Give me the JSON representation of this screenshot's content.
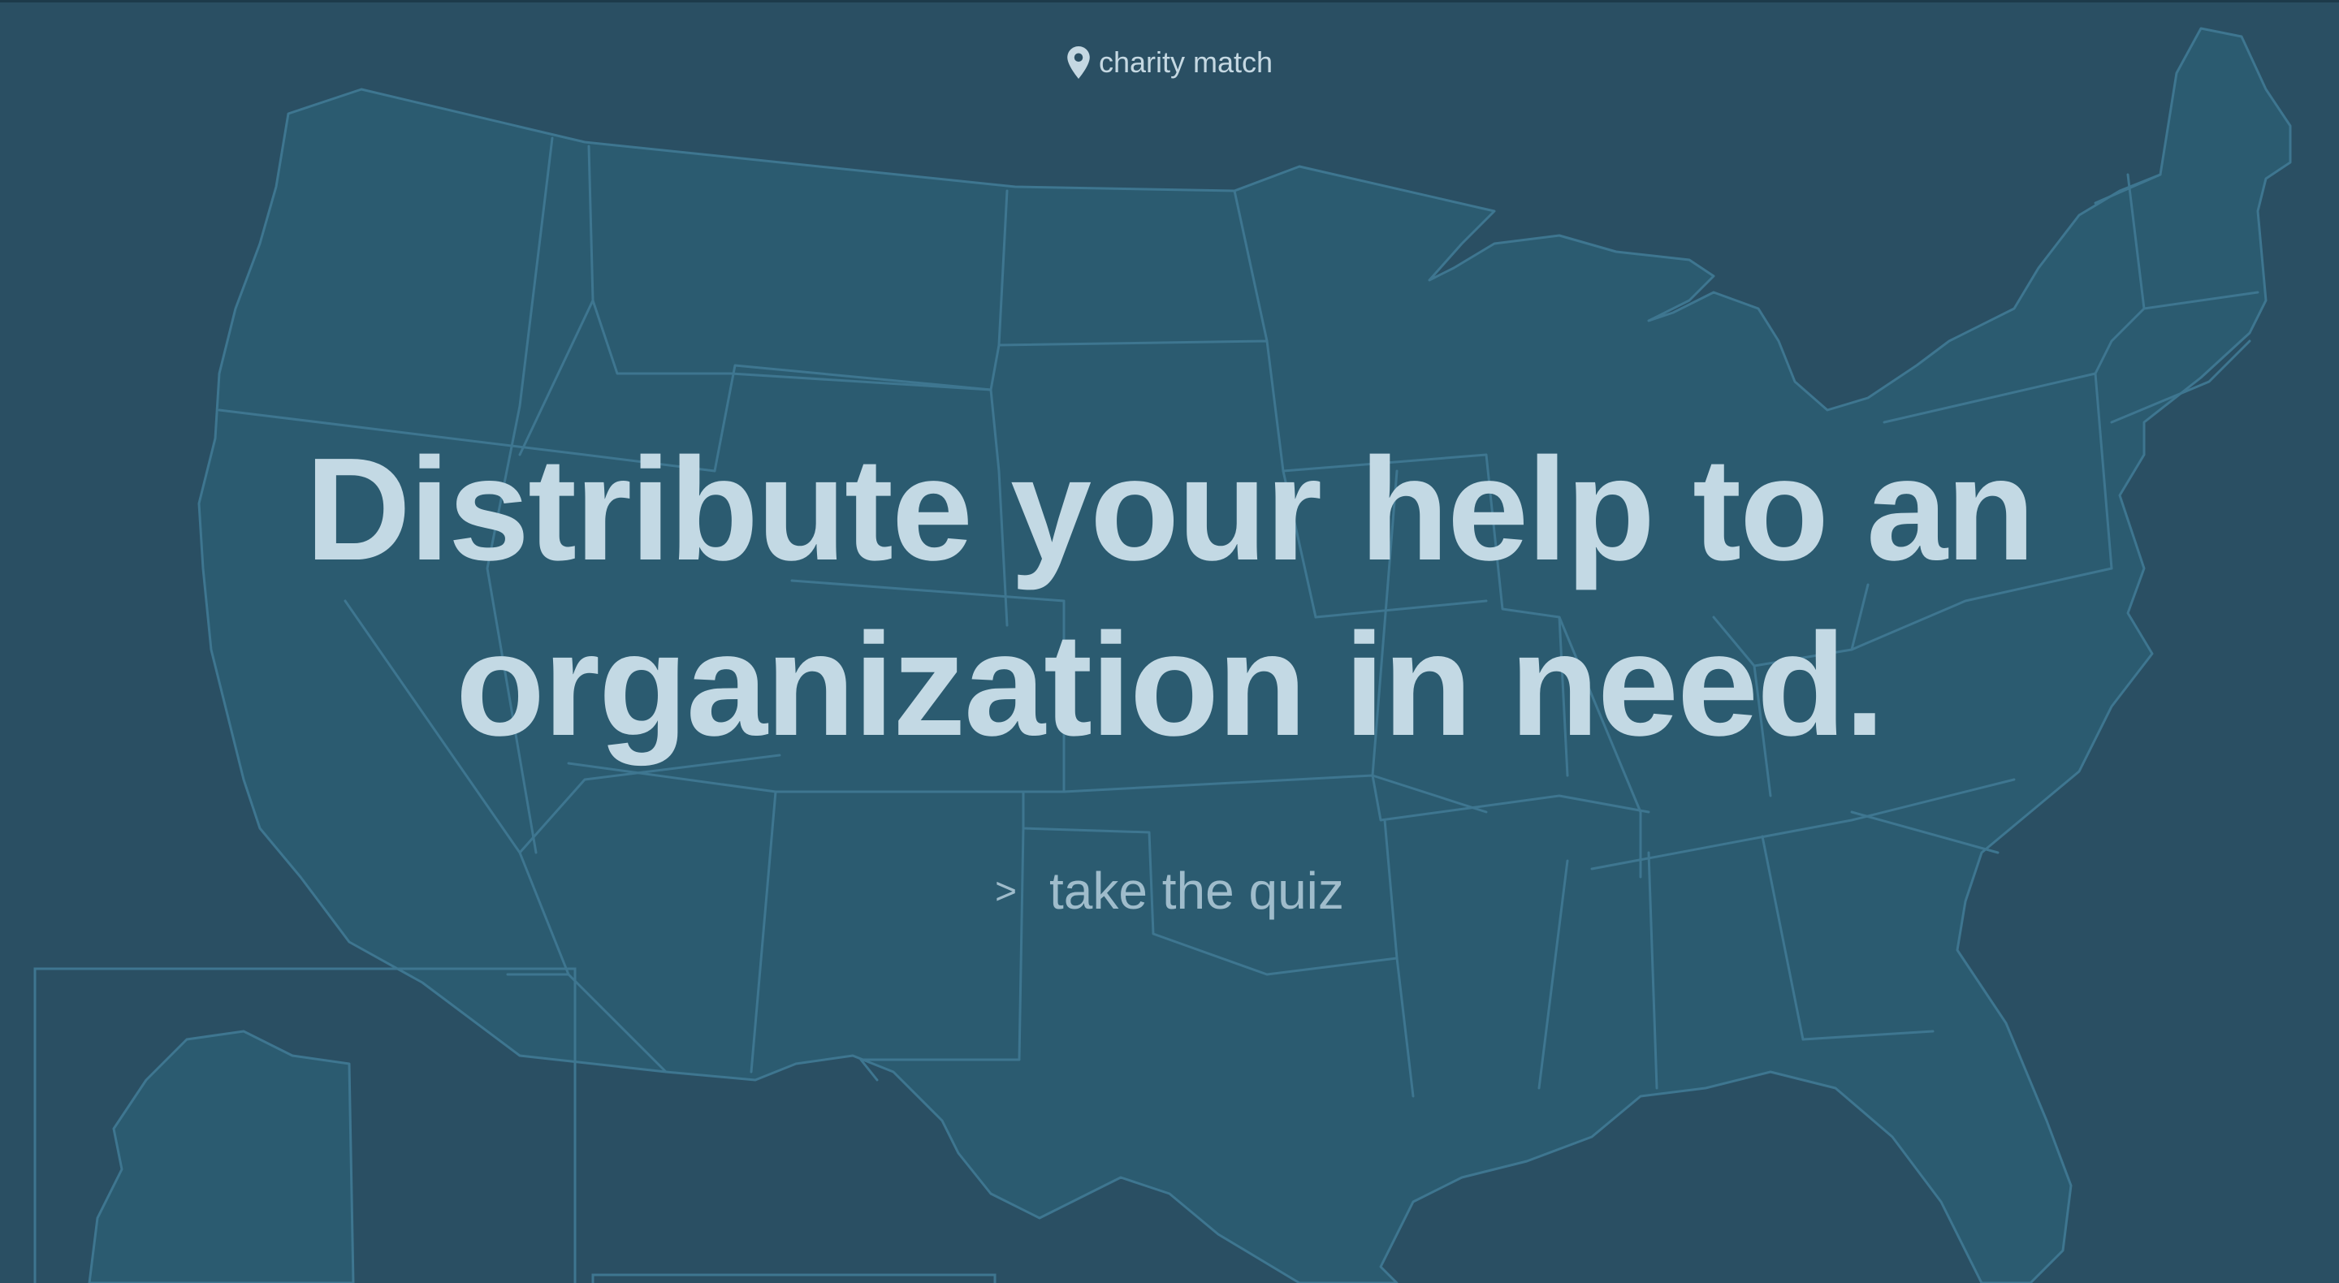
{
  "brand": {
    "name": "charity match",
    "icon": "map-pin-icon"
  },
  "hero": {
    "line1": "Distribute your help to an",
    "line2": "organization in need."
  },
  "cta": {
    "arrow": ">",
    "label": "take the quiz"
  },
  "colors": {
    "background": "#2a4f63",
    "map_fill": "#2b5b70",
    "map_stroke": "#3e7690",
    "headline": "#c3d9e4",
    "cta_text": "#9fbccb"
  }
}
